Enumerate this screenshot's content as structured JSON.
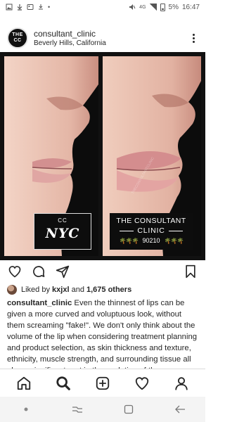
{
  "status_bar": {
    "network": "4G",
    "battery": "5%",
    "time": "16:47"
  },
  "post": {
    "username": "consultant_clinic",
    "location": "Beverly Hills, California",
    "avatar_text": "THE CC"
  },
  "image": {
    "left_badge_small": "CC",
    "left_badge_big": "NYC",
    "right_badge_line1": "THE CONSULTANT",
    "right_badge_line2": "CLINIC",
    "right_badge_zip": "90210",
    "watermark": "THECONSULTANTCLINIC"
  },
  "likes": {
    "prefix": "Liked by",
    "user": "kxjxl",
    "and": "and",
    "others": "1,675 others"
  },
  "caption": {
    "username": "consultant_clinic",
    "text": "Even the thinnest of lips can be given a more curved and voluptuous look, without them screaming \"fake!\". We don't only think about the volume of the lip when considering treatment planning and product selection, as skin thickness and texture, ethnicity, muscle strength, and surrounding tissue all play a significant part in the evolution of the"
  },
  "bottom_nav": {
    "icons": [
      "home-icon",
      "search-icon",
      "add-post-icon",
      "heart-icon",
      "profile-icon"
    ]
  },
  "android_nav": {
    "icons": [
      "dot-icon",
      "recent-apps-icon",
      "home-square-icon",
      "back-icon"
    ]
  },
  "colors": {
    "text": "#262626",
    "divider": "#dbdbdb",
    "image_bg": "#111111",
    "skin_light": "#e9c3b3",
    "skin_mid": "#d6a193",
    "lip": "#d98d8f"
  }
}
